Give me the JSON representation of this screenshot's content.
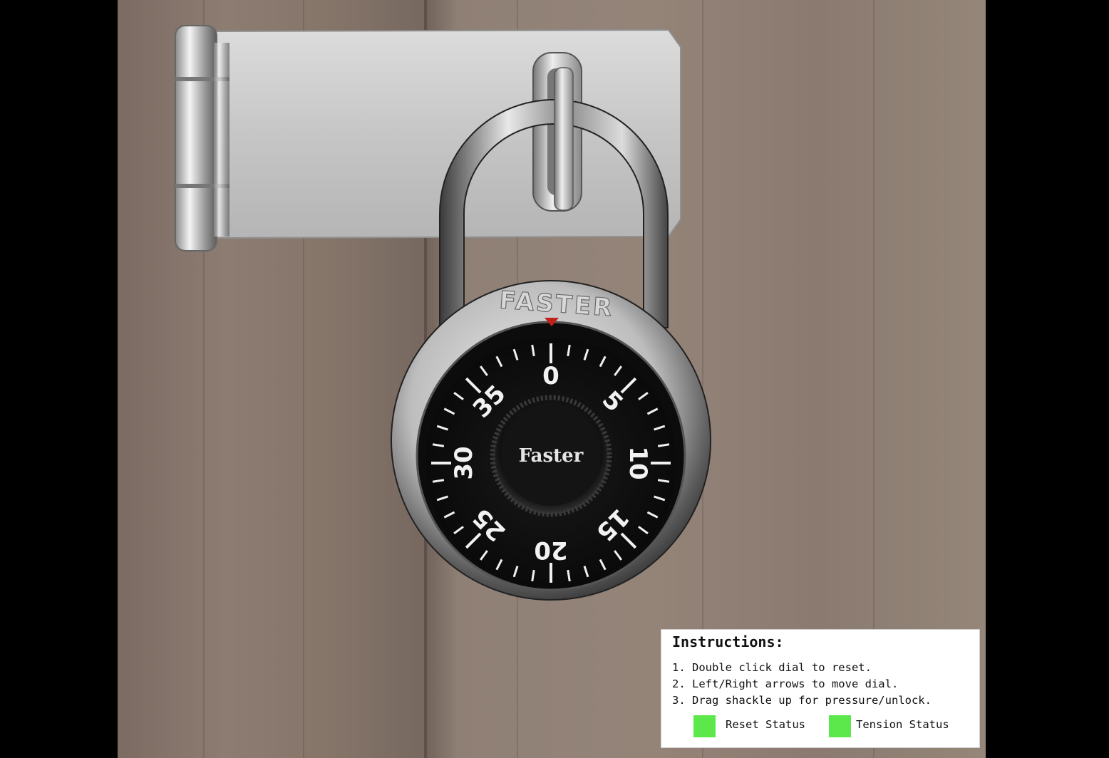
{
  "lock": {
    "brand_top": "FASTER",
    "brand_center": "Faster",
    "dial_numbers": [
      "0",
      "5",
      "10",
      "15",
      "20",
      "25",
      "30",
      "35"
    ],
    "dial_value": 0,
    "pointer_color": "#c0221a"
  },
  "instructions": {
    "title": "Instructions:",
    "lines": [
      "1. Double click dial to reset.",
      "2. Left/Right arrows to move dial.",
      "3. Drag shackle up for pressure/unlock."
    ],
    "reset_status_label": "Reset Status",
    "tension_status_label": "Tension Status",
    "reset_status_color": "#5ce84a",
    "tension_status_color": "#5ce84a"
  }
}
